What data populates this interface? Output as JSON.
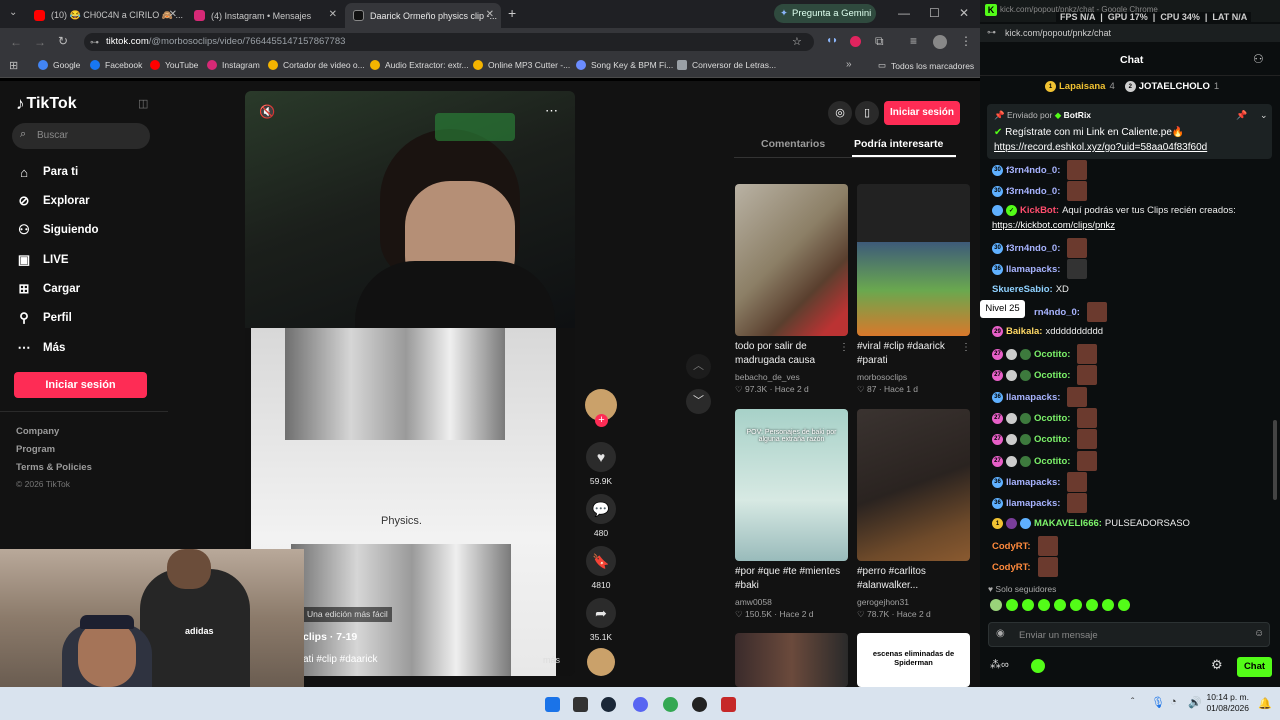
{
  "browser": {
    "tabs": [
      {
        "label": "(10) 😂 CH0C4N a CIRILO 🙈 ...",
        "favicon_color": "#ff0000"
      },
      {
        "label": "(4) Instagram • Mensajes",
        "favicon_color": "#d62976"
      },
      {
        "label": "Daarick Ormeño physics clip -...",
        "favicon_color": "#ffffff"
      }
    ],
    "new_tab": "+",
    "gemini_button": "Pregunta a Gemini",
    "url_prefix": "tiktok.com",
    "url_path": "/@morbosoclips/video/7664455147157867783",
    "bookmarks": [
      {
        "label": "Google",
        "color": "#4285f4"
      },
      {
        "label": "Facebook",
        "color": "#1877f2"
      },
      {
        "label": "YouTube",
        "color": "#ff0000"
      },
      {
        "label": "Instagram",
        "color": "#d62976"
      },
      {
        "label": "Cortador de video o...",
        "color": "#f4b400"
      },
      {
        "label": "Audio Extractor: extr...",
        "color": "#f4b400"
      },
      {
        "label": "Online MP3 Cutter -...",
        "color": "#f4b400"
      },
      {
        "label": "Song Key & BPM Fi...",
        "color": "#6b8cff"
      },
      {
        "label": "Conversor de Letras...",
        "color": "#9aa0a6"
      }
    ],
    "all_bookmarks": "Todos los marcadores"
  },
  "tiktok": {
    "logo": "TikTok",
    "search_placeholder": "Buscar",
    "nav": [
      "Para ti",
      "Explorar",
      "Siguiendo",
      "LIVE",
      "Cargar",
      "Perfil",
      "Más"
    ],
    "login_button": "Iniciar sesión",
    "footer": [
      "Company",
      "Program",
      "Terms & Policies",
      "© 2026 TikTok"
    ],
    "video": {
      "caption_overlay": "Physics.",
      "edit_label": "Una edición más fácil",
      "author": "clips · 7-19",
      "hashtags": "ati #clip #daarick",
      "more": "más"
    },
    "actions": {
      "likes": "59.9K",
      "comments": "480",
      "saves": "4810",
      "shares": "35.1K"
    },
    "right": {
      "login_button": "Iniciar sesión",
      "tabs": [
        "Comentarios",
        "Podría interesarte"
      ],
      "active_tab": "Podría interesarte",
      "cards": [
        {
          "title": "todo por salir de madrugada causa",
          "user": "bebacho_de_ves",
          "views": "97.3K",
          "age": "Hace 2 d"
        },
        {
          "title": "#viral #clip #daarick #parati",
          "user": "morbosoclips",
          "views": "87",
          "age": "Hace 1 d"
        },
        {
          "title": "#por #que #te #mientes #baki",
          "user": "amw0058",
          "views": "150.5K",
          "age": "Hace 2 d",
          "thumb_text": "POV: Personajes de baki por alguna extraña razón"
        },
        {
          "title": "#perro #carlitos #alanwalker...",
          "user": "gerogejhon31",
          "views": "78.7K",
          "age": "Hace 2 d"
        },
        {
          "title": "",
          "user": "",
          "views": "",
          "age": ""
        },
        {
          "title": "",
          "user": "",
          "views": "",
          "age": "",
          "thumb_text": "escenas eliminadas de Spiderman"
        }
      ]
    }
  },
  "kick": {
    "window_title": "kick.com/popout/pnkz/chat - Google Chrome",
    "stats": {
      "fps_label": "FPS",
      "fps": "N/A",
      "gpu_label": "GPU",
      "gpu": "17%",
      "cpu_label": "CPU",
      "cpu": "34%",
      "lat_label": "LAT",
      "lat": "N/A"
    },
    "url": "kick.com/popout/pnkz/chat",
    "header": "Chat",
    "leaders": [
      {
        "name": "Lapaisana",
        "count": "4"
      },
      {
        "name": "JOTAELCHOLO",
        "count": "1"
      }
    ],
    "pinned": {
      "sent_by_label": "Enviado por",
      "sent_by": "BotRix",
      "text": "Regístrate con mi Link en Caliente.pe🔥",
      "link": "https://record.eshkol.xyz/go?uid=58aa04f83f60d"
    },
    "messages": [
      {
        "user": "f3rn4ndo_0:",
        "text": "",
        "color": "#a8b4ff",
        "emote": true
      },
      {
        "user": "f3rn4ndo_0:",
        "text": "",
        "color": "#a8b4ff",
        "emote": true
      },
      {
        "user": "KickBot:",
        "text": "Aquí podrás ver tus Clips recién creados:",
        "color": "#ff4d6d",
        "emote": false
      },
      {
        "user": "",
        "text": "https://kickbot.com/clips/pnkz",
        "color": "#ffffff",
        "emote": false
      },
      {
        "user": "f3rn4ndo_0:",
        "text": "",
        "color": "#a8b4ff",
        "emote": true
      },
      {
        "user": "llamapacks:",
        "text": "",
        "color": "#a8b4ff",
        "emote": true
      },
      {
        "user": "SkuereSabio:",
        "text": "XD",
        "color": "#8fd1ff",
        "emote": false
      },
      {
        "user": "rn4ndo_0:",
        "text": "",
        "color": "#a8b4ff",
        "emote": true
      },
      {
        "user": "Baikala:",
        "text": "xdddddddddd",
        "color": "#ffd966",
        "emote": false
      },
      {
        "user": "Ocotito:",
        "text": "",
        "color": "#7cf26a",
        "emote": true
      },
      {
        "user": "Ocotito:",
        "text": "",
        "color": "#7cf26a",
        "emote": true
      },
      {
        "user": "llamapacks:",
        "text": "",
        "color": "#a8b4ff",
        "emote": true
      },
      {
        "user": "Ocotito:",
        "text": "",
        "color": "#7cf26a",
        "emote": true
      },
      {
        "user": "Ocotito:",
        "text": "",
        "color": "#7cf26a",
        "emote": true
      },
      {
        "user": "Ocotito:",
        "text": "",
        "color": "#7cf26a",
        "emote": true
      },
      {
        "user": "llamapacks:",
        "text": "",
        "color": "#a8b4ff",
        "emote": true
      },
      {
        "user": "llamapacks:",
        "text": "",
        "color": "#a8b4ff",
        "emote": true
      },
      {
        "user": "MAKAVELI666:",
        "text": "PULSEADORSASO",
        "color": "#7cf26a",
        "emote": false
      },
      {
        "user": "CodyRT:",
        "text": "",
        "color": "#ff8a3d",
        "emote": true
      },
      {
        "user": "CodyRT:",
        "text": "",
        "color": "#ff8a3d",
        "emote": true
      }
    ],
    "tooltip": "Nivel 25",
    "followers_only": "Solo seguidores",
    "input_placeholder": "Enviar un mensaje",
    "chat_button": "Chat"
  },
  "taskbar": {
    "time": "10:14 p. m.",
    "date": "01/08/2026"
  }
}
